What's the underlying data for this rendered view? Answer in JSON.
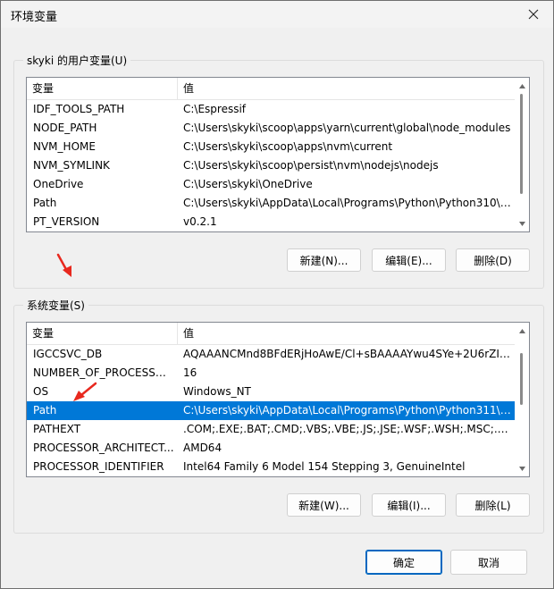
{
  "window": {
    "title": "环境变量"
  },
  "user_vars": {
    "group_label": "skyki 的用户变量(U)",
    "columns": [
      "变量",
      "值"
    ],
    "rows": [
      {
        "name": "IDF_TOOLS_PATH",
        "value": "C:\\Espressif"
      },
      {
        "name": "NODE_PATH",
        "value": "C:\\Users\\skyki\\scoop\\apps\\yarn\\current\\global\\node_modules"
      },
      {
        "name": "NVM_HOME",
        "value": "C:\\Users\\skyki\\scoop\\apps\\nvm\\current"
      },
      {
        "name": "NVM_SYMLINK",
        "value": "C:\\Users\\skyki\\scoop\\persist\\nvm\\nodejs\\nodejs"
      },
      {
        "name": "OneDrive",
        "value": "C:\\Users\\skyki\\OneDrive"
      },
      {
        "name": "Path",
        "value": "C:\\Users\\skyki\\AppData\\Local\\Programs\\Python\\Python310\\S..."
      },
      {
        "name": "PT_VERSION",
        "value": "v0.2.1"
      }
    ],
    "buttons": {
      "new": "新建(N)...",
      "edit": "编辑(E)...",
      "delete": "删除(D)"
    }
  },
  "system_vars": {
    "group_label": "系统变量(S)",
    "columns": [
      "变量",
      "值"
    ],
    "rows": [
      {
        "name": "IGCCSVC_DB",
        "value": "AQAAANCMnd8BFdERjHoAwE/Cl+sBAAAAYwu4SYe+2U6rZI1..."
      },
      {
        "name": "NUMBER_OF_PROCESSORS",
        "value": "16"
      },
      {
        "name": "OS",
        "value": "Windows_NT"
      },
      {
        "name": "Path",
        "value": "C:\\Users\\skyki\\AppData\\Local\\Programs\\Python\\Python311\\S..."
      },
      {
        "name": "PATHEXT",
        "value": ".COM;.EXE;.BAT;.CMD;.VBS;.VBE;.JS;.JSE;.WSF;.WSH;.MSC;.PY;.P..."
      },
      {
        "name": "PROCESSOR_ARCHITECT...",
        "value": "AMD64"
      },
      {
        "name": "PROCESSOR_IDENTIFIER",
        "value": "Intel64 Family 6 Model 154 Stepping 3, GenuineIntel"
      }
    ],
    "selected_row": "Path",
    "buttons": {
      "new": "新建(W)...",
      "edit": "编辑(I)...",
      "delete": "删除(L)"
    }
  },
  "footer": {
    "ok": "确定",
    "cancel": "取消"
  },
  "colors": {
    "selection": "#0078d7",
    "annotation_arrow": "#e8281e"
  },
  "icons": [
    "close-icon",
    "scroll-up-icon",
    "scroll-down-icon",
    "red-arrow-annotation"
  ]
}
